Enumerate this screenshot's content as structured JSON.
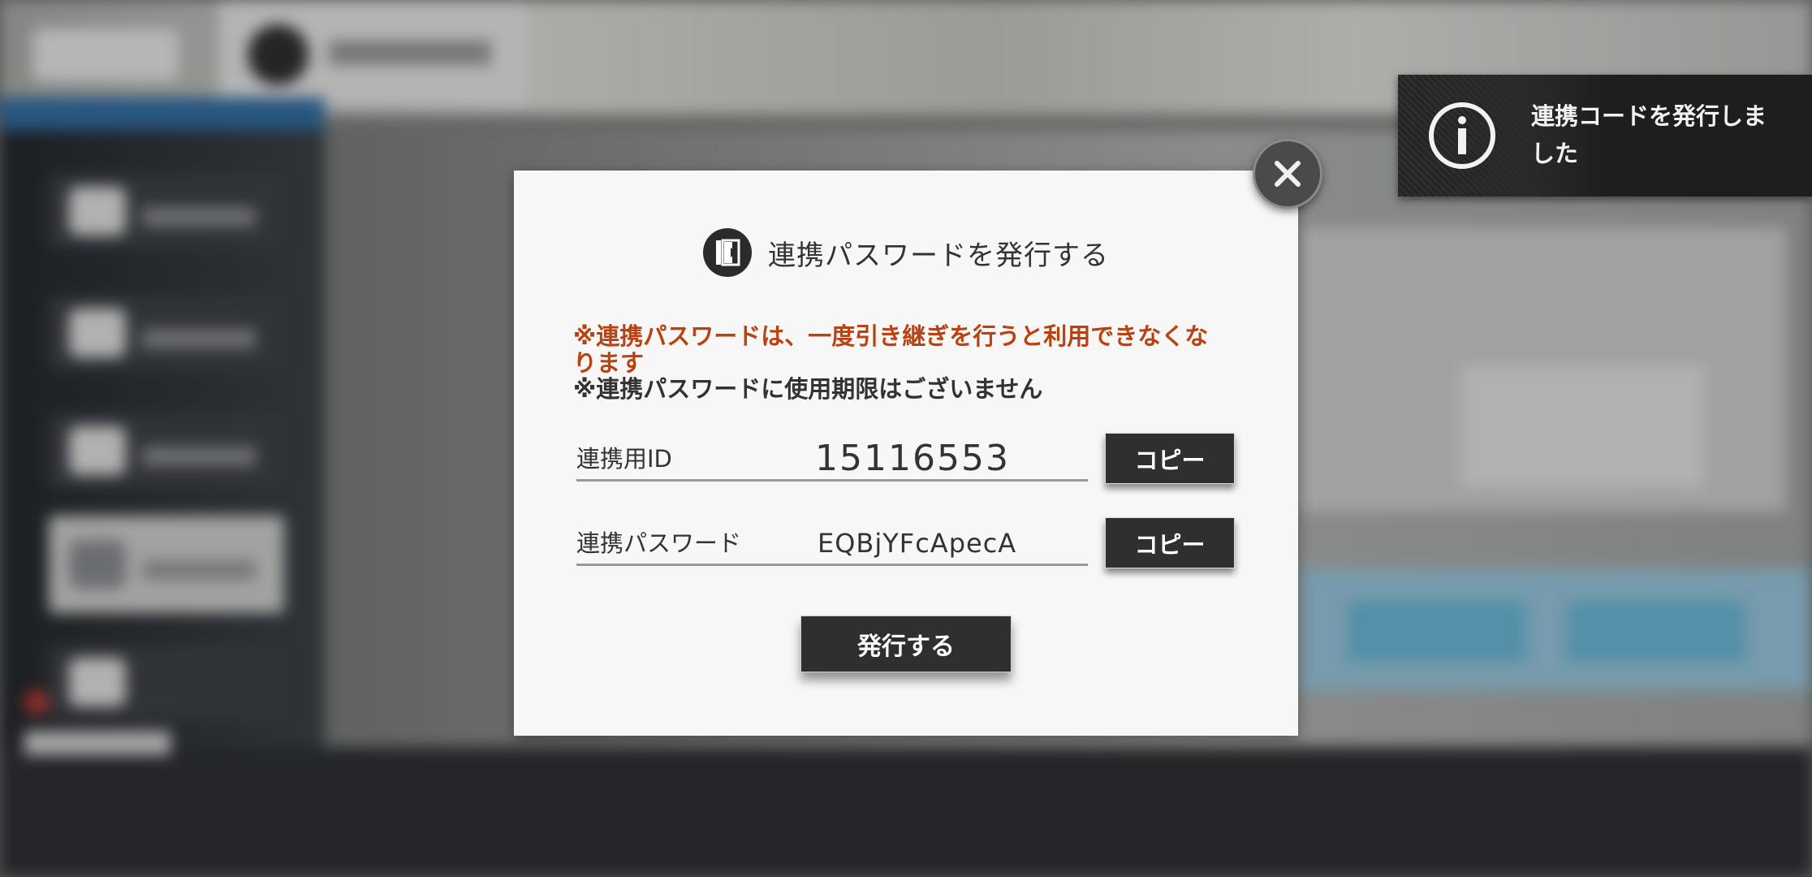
{
  "dialog": {
    "title": "連携パスワードを発行する",
    "title_icon": "transfer-door-icon",
    "warning_line1": "※連携パスワードは、一度引き継ぎを行うと利用できなくな",
    "warning_line2": "ります",
    "info": "※連携パスワードに使用期限はございません",
    "id_field": {
      "label": "連携用ID",
      "value": "15116553",
      "copy_label": "コピー"
    },
    "password_field": {
      "label": "連携パスワード",
      "value": "EQBjYFcApecA",
      "copy_label": "コピー"
    },
    "issue_button_label": "発行する",
    "close_icon": "close-icon"
  },
  "toast": {
    "icon": "info-icon",
    "line1": "連携コードを発行しま",
    "line2": "した"
  },
  "colors": {
    "warning_text": "#b84210",
    "button_bg": "#2f2f2f",
    "dialog_bg": "#f7f7f7"
  }
}
